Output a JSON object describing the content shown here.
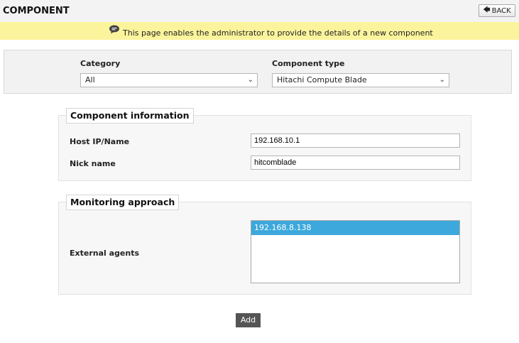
{
  "header": {
    "title": "COMPONENT",
    "back_label": "BACK"
  },
  "info": {
    "text": "This page enables the administrator to provide the details of a new component"
  },
  "selectors": {
    "category_label": "Category",
    "category_value": "All",
    "component_type_label": "Component type",
    "component_type_value": "Hitachi Compute Blade"
  },
  "component_info": {
    "legend": "Component information",
    "host_label": "Host IP/Name",
    "host_value": "192.168.10.1",
    "nick_label": "Nick name",
    "nick_value": "hitcomblade"
  },
  "monitoring": {
    "legend": "Monitoring approach",
    "agents_label": "External agents",
    "agents": [
      "192.168.8.138"
    ]
  },
  "actions": {
    "add_label": "Add"
  },
  "colors": {
    "info_bar": "#fbf49c",
    "selected_option": "#3ca8dc",
    "add_button": "#555555"
  }
}
